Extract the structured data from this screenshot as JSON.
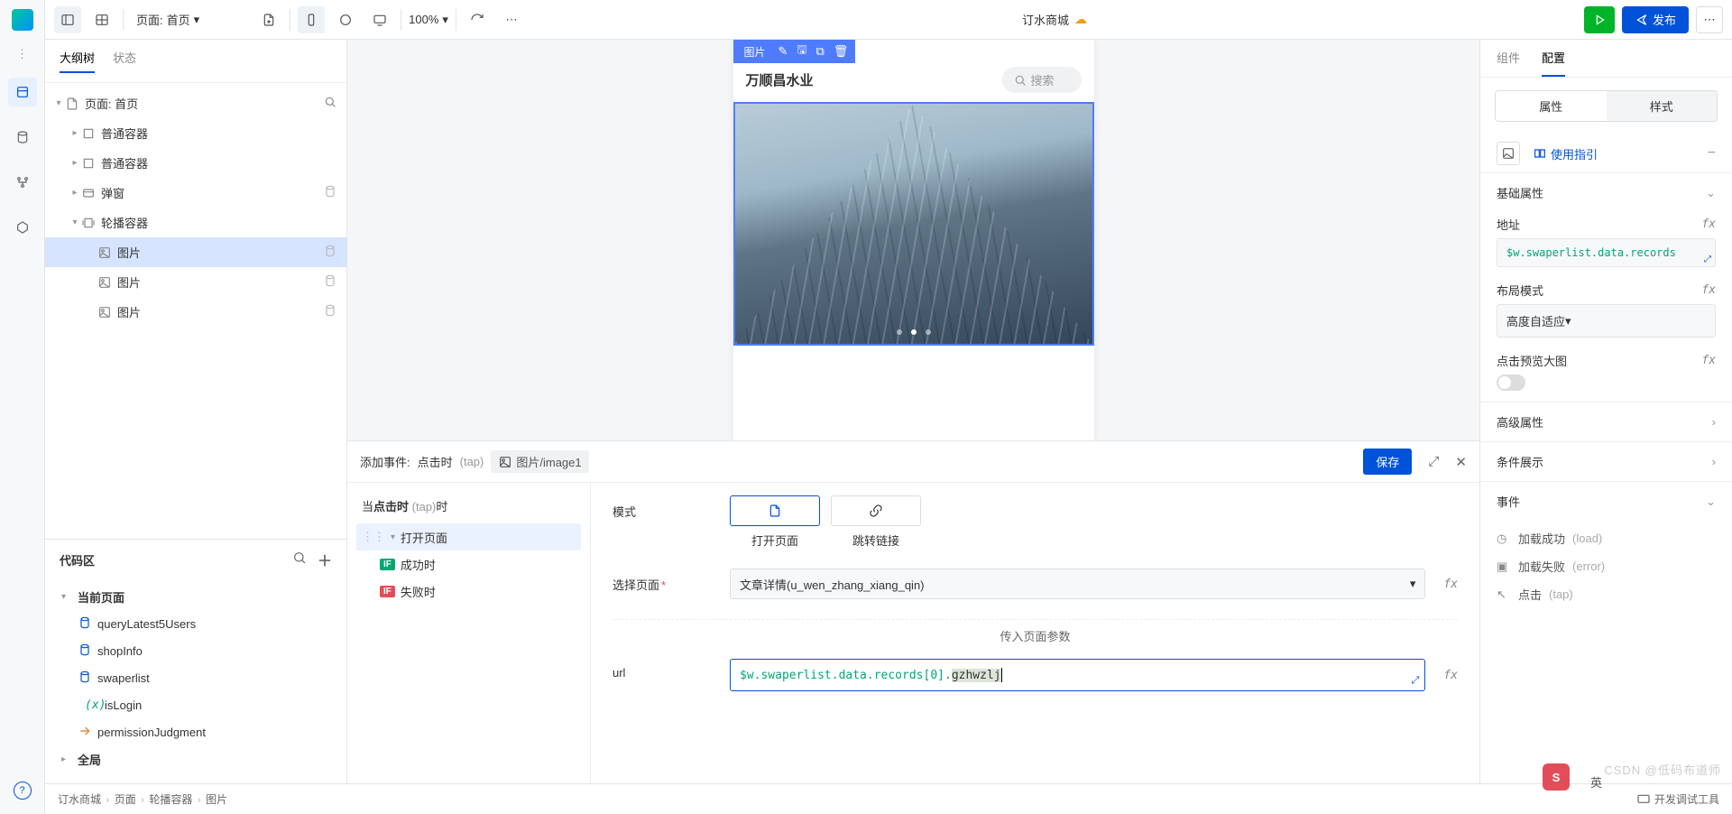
{
  "topbar": {
    "page_label_prefix": "页面:",
    "page_name": "首页",
    "zoom": "100%",
    "app_title": "订水商城",
    "publish": "发布"
  },
  "left": {
    "tabs": {
      "outline": "大纲树",
      "state": "状态"
    },
    "tree": [
      {
        "label": "页面: 首页",
        "icon": "file",
        "depth": 0,
        "caret": "down",
        "right": "search"
      },
      {
        "label": "普通容器",
        "icon": "box",
        "depth": 1,
        "caret": "right"
      },
      {
        "label": "普通容器",
        "icon": "box",
        "depth": 1,
        "caret": "right"
      },
      {
        "label": "弹窗",
        "icon": "modal",
        "depth": 1,
        "caret": "right",
        "right": "db"
      },
      {
        "label": "轮播容器",
        "icon": "carousel",
        "depth": 1,
        "caret": "down"
      },
      {
        "label": "图片",
        "icon": "image",
        "depth": 2,
        "selected": true,
        "right": "db"
      },
      {
        "label": "图片",
        "icon": "image",
        "depth": 2,
        "right": "db"
      },
      {
        "label": "图片",
        "icon": "image",
        "depth": 2,
        "right": "db"
      }
    ],
    "code": {
      "header": "代码区",
      "groups": [
        {
          "label": "当前页面",
          "caret": "down",
          "items": [
            {
              "label": "queryLatest5Users",
              "icon": "db"
            },
            {
              "label": "shopInfo",
              "icon": "db"
            },
            {
              "label": "swaperlist",
              "icon": "db"
            },
            {
              "label": "isLogin",
              "icon": "fx"
            },
            {
              "label": "permissionJudgment",
              "icon": "ar"
            }
          ]
        },
        {
          "label": "全局",
          "caret": "right",
          "items": []
        }
      ]
    }
  },
  "device": {
    "sel_tag": "图片",
    "header_title": "万顺昌水业",
    "search_placeholder": "搜索",
    "active_dot": 1
  },
  "event": {
    "title_prefix": "添加事件:",
    "title_event": "点击时",
    "title_tap": "(tap)",
    "chip": "图片/image1",
    "save": "保存",
    "when_prefix": "当",
    "when_event": "点击时",
    "when_tap": "(tap)",
    "when_suffix": "时",
    "actions": [
      {
        "label": "打开页面",
        "selected": true,
        "caret": true,
        "handle": true
      },
      {
        "label": "成功时",
        "badge": "IF",
        "badge_type": "ok",
        "indent": 1
      },
      {
        "label": "失败时",
        "badge": "IF",
        "badge_type": "err",
        "indent": 1
      }
    ],
    "form": {
      "mode_label": "模式",
      "mode_opts": [
        {
          "label": "打开页面",
          "active": true,
          "icon": "file"
        },
        {
          "label": "跳转链接",
          "active": false,
          "icon": "link"
        }
      ],
      "page_label": "选择页面",
      "page_required": true,
      "page_value": "文章详情(u_wen_zhang_xiang_qin)",
      "params_header": "传入页面参数",
      "url_label": "url",
      "url_expr_pre": "$w.swaperlist.data.records[0].",
      "url_expr_suf": "gzhwzlj"
    }
  },
  "right": {
    "tabs": {
      "component": "组件",
      "config": "配置"
    },
    "seg": {
      "attr": "属性",
      "style": "样式"
    },
    "guide": "使用指引",
    "sections": {
      "base": {
        "title": "基础属性",
        "src_label": "地址",
        "src_expr": "$w.swaperlist.data.records",
        "layout_label": "布局模式",
        "layout_value": "高度自适应",
        "preview_label": "点击预览大图"
      },
      "adv": "高级属性",
      "cond": "条件展示",
      "events": {
        "title": "事件",
        "items": [
          {
            "label": "加载成功",
            "hint": "(load)",
            "icon": "clock"
          },
          {
            "label": "加载失败",
            "hint": "(error)",
            "icon": "warn"
          },
          {
            "label": "点击",
            "hint": "(tap)",
            "icon": "cursor"
          }
        ]
      }
    }
  },
  "breadcrumb": [
    "订水商城",
    "页面",
    "轮播容器",
    "图片"
  ],
  "breadcrumb_tool": "开发调试工具",
  "watermark": "CSDN @低码布道师"
}
